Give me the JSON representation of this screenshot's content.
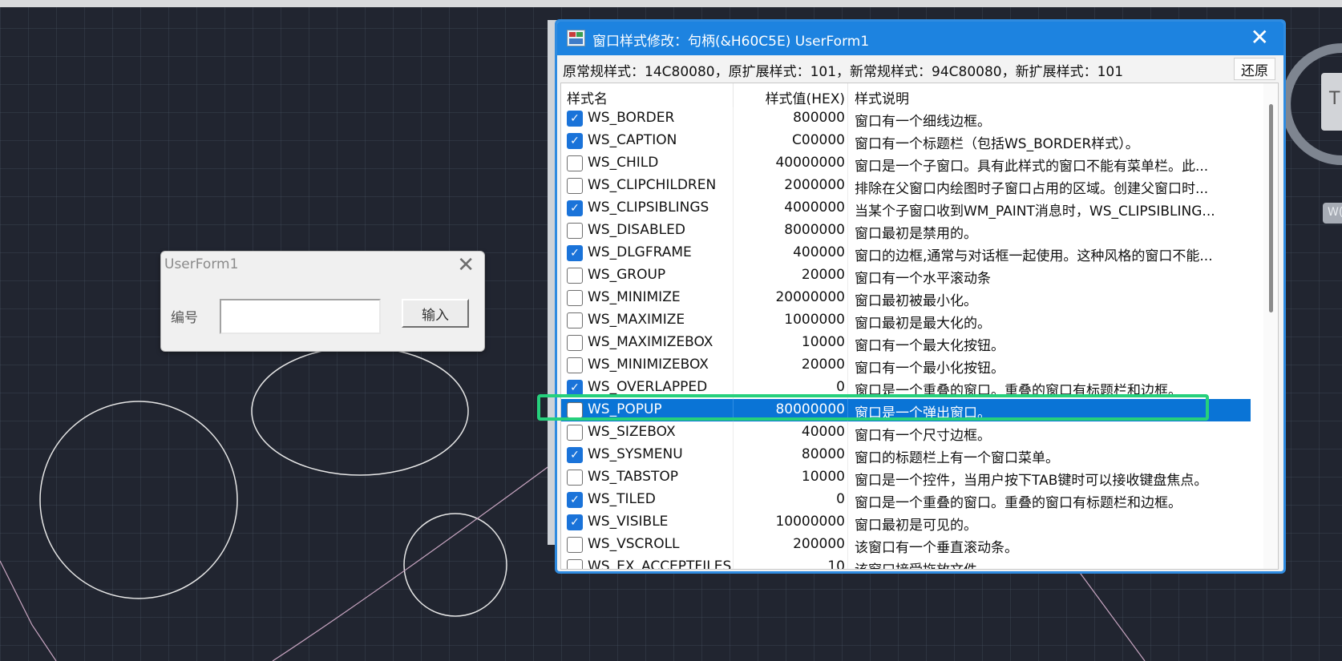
{
  "colors": {
    "canvas_bg": "#212530",
    "dialog_titlebar": "#1d83e0",
    "checkbox_checked": "#1a73d9",
    "selected_row": "#0a74d6",
    "highlight_box": "#26d07c"
  },
  "userform": {
    "title": "UserForm1",
    "close_glyph": "✕",
    "label": "编号",
    "input_value": "",
    "button_label": "输入"
  },
  "right_edge": {
    "icon_letter": "T",
    "badge_text": "W("
  },
  "dialog": {
    "title": "窗口样式修改：句柄(&H60C5E) UserForm1",
    "close_glyph": "✕",
    "info": "原常规样式：14C80080，原扩展样式：101，新常规样式：94C80080，新扩展样式：101",
    "restore_label": "还原",
    "columns": {
      "name": "样式名",
      "hex": "样式值(HEX)",
      "desc": "样式说明"
    },
    "rows": [
      {
        "checked": true,
        "name": "WS_BORDER",
        "hex": "800000",
        "desc": "窗口有一个细线边框。"
      },
      {
        "checked": true,
        "name": "WS_CAPTION",
        "hex": "C00000",
        "desc": "窗口有一个标题栏（包括WS_BORDER样式）。"
      },
      {
        "checked": false,
        "name": "WS_CHILD",
        "hex": "40000000",
        "desc": "窗口是一个子窗口。具有此样式的窗口不能有菜单栏。此..."
      },
      {
        "checked": false,
        "name": "WS_CLIPCHILDREN",
        "hex": "2000000",
        "desc": "排除在父窗口内绘图时子窗口占用的区域。创建父窗口时..."
      },
      {
        "checked": true,
        "name": "WS_CLIPSIBLINGS",
        "hex": "4000000",
        "desc": "当某个子窗口收到WM_PAINT消息时，WS_CLIPSIBLING..."
      },
      {
        "checked": false,
        "name": "WS_DISABLED",
        "hex": "8000000",
        "desc": "窗口最初是禁用的。"
      },
      {
        "checked": true,
        "name": "WS_DLGFRAME",
        "hex": "400000",
        "desc": "窗口的边框,通常与对话框一起使用。这种风格的窗口不能..."
      },
      {
        "checked": false,
        "name": "WS_GROUP",
        "hex": "20000",
        "desc": "窗口有一个水平滚动条"
      },
      {
        "checked": false,
        "name": "WS_MINIMIZE",
        "hex": "20000000",
        "desc": "窗口最初被最小化。"
      },
      {
        "checked": false,
        "name": "WS_MAXIMIZE",
        "hex": "1000000",
        "desc": "窗口最初是最大化的。"
      },
      {
        "checked": false,
        "name": "WS_MAXIMIZEBOX",
        "hex": "10000",
        "desc": "窗口有一个最大化按钮。"
      },
      {
        "checked": false,
        "name": "WS_MINIMIZEBOX",
        "hex": "20000",
        "desc": "窗口有一个最小化按钮。"
      },
      {
        "checked": true,
        "name": "WS_OVERLAPPED",
        "hex": "0",
        "desc": "窗口是一个重叠的窗口。重叠的窗口有标题栏和边框。"
      },
      {
        "checked": false,
        "name": "WS_POPUP",
        "hex": "80000000",
        "desc": "窗口是一个弹出窗口。",
        "selected": true
      },
      {
        "checked": false,
        "name": "WS_SIZEBOX",
        "hex": "40000",
        "desc": "窗口有一个尺寸边框。"
      },
      {
        "checked": true,
        "name": "WS_SYSMENU",
        "hex": "80000",
        "desc": "窗口的标题栏上有一个窗口菜单。"
      },
      {
        "checked": false,
        "name": "WS_TABSTOP",
        "hex": "10000",
        "desc": "窗口是一个控件，当用户按下TAB键时可以接收键盘焦点。"
      },
      {
        "checked": true,
        "name": "WS_TILED",
        "hex": "0",
        "desc": "窗口是一个重叠的窗口。重叠的窗口有标题栏和边框。"
      },
      {
        "checked": true,
        "name": "WS_VISIBLE",
        "hex": "10000000",
        "desc": "窗口最初是可见的。"
      },
      {
        "checked": false,
        "name": "WS_VSCROLL",
        "hex": "200000",
        "desc": "该窗口有一个垂直滚动条。"
      },
      {
        "checked": false,
        "name": "WS_EX_ACCEPTFILES",
        "hex": "10",
        "desc": "该窗口接受拖放文件。"
      }
    ]
  }
}
